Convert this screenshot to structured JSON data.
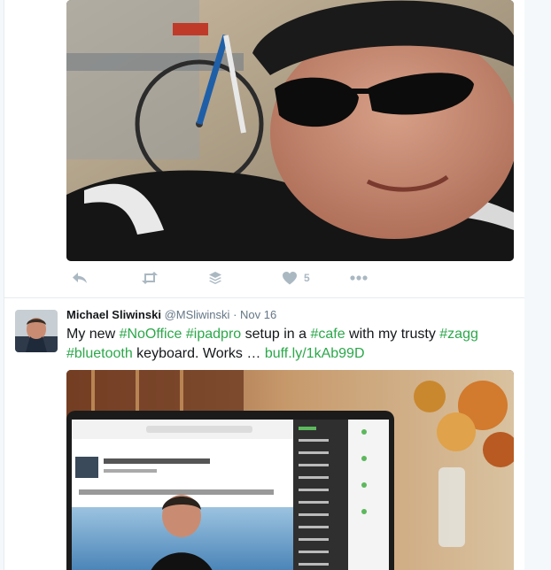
{
  "tweet1": {
    "actions": {
      "reply_icon": "reply-icon",
      "retweet_icon": "retweet-icon",
      "buffer_icon": "buffer-stack-icon",
      "like_icon": "heart-icon",
      "like_count": "5",
      "more_icon": "more-icon"
    }
  },
  "tweet2": {
    "fullname": "Michael Sliwinski",
    "username": "@MSliwinski",
    "separator": "·",
    "time": "Nov 16",
    "text_parts": {
      "p1": "My new ",
      "h1": "#NoOffice",
      "p2": " ",
      "h2": "#ipadpro",
      "p3": " setup in a ",
      "h3": "#cafe",
      "p4": " with my trusty ",
      "h4": "#zagg",
      "p5": " ",
      "h5": "#bluetooth",
      "p6": " keyboard. Works … ",
      "link": "buff.ly/1kAb99D"
    }
  },
  "colors": {
    "hashtag": "#2ba84a",
    "muted": "#657786",
    "icon": "#aab8c2",
    "border": "#e6ecf0"
  }
}
